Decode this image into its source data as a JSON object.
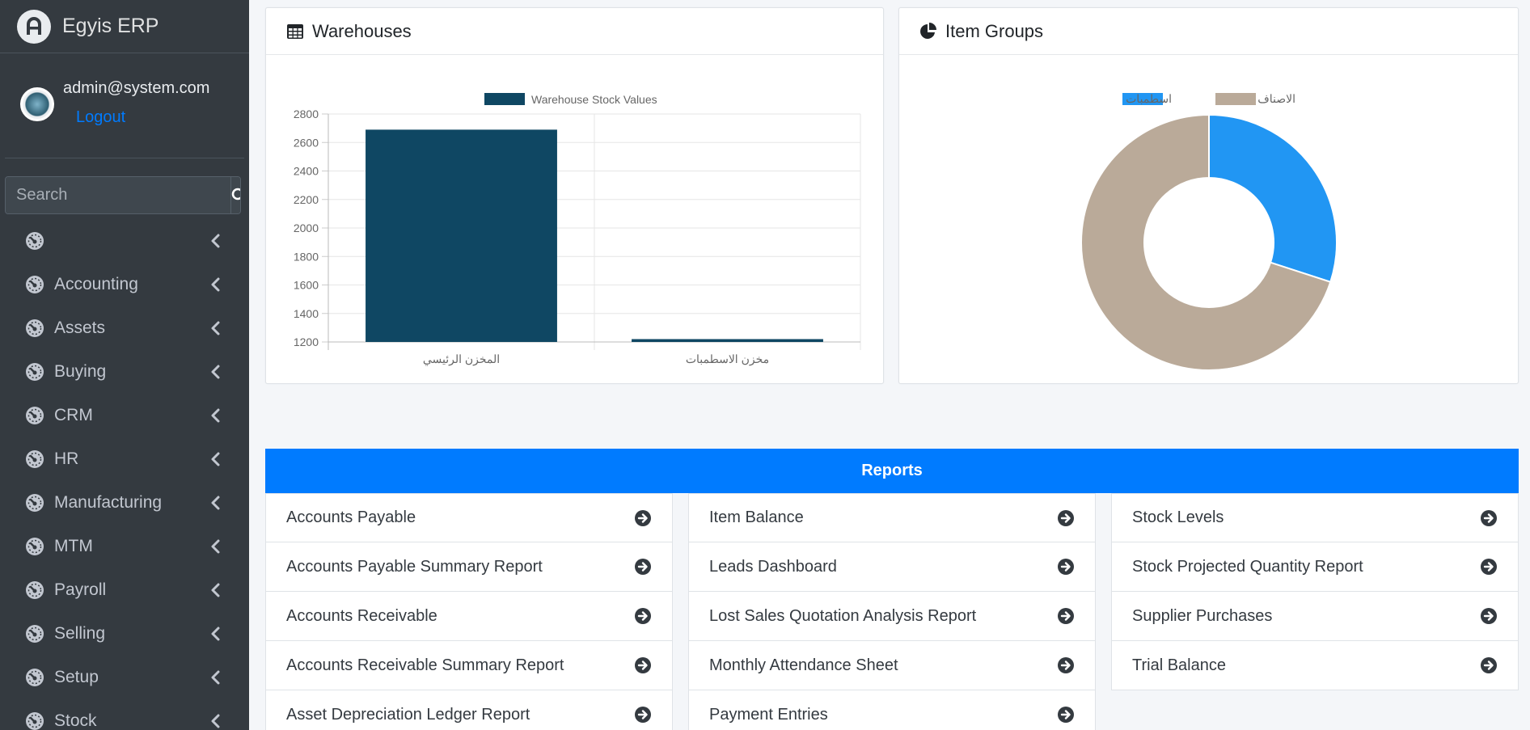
{
  "brand": {
    "name": "Egyis ERP"
  },
  "user": {
    "email": "admin@system.com",
    "logout_label": "Logout"
  },
  "search": {
    "placeholder": "Search"
  },
  "nav": [
    {
      "label": ""
    },
    {
      "label": "Accounting"
    },
    {
      "label": "Assets"
    },
    {
      "label": "Buying"
    },
    {
      "label": "CRM"
    },
    {
      "label": "HR"
    },
    {
      "label": "Manufacturing"
    },
    {
      "label": "MTM"
    },
    {
      "label": "Payroll"
    },
    {
      "label": "Selling"
    },
    {
      "label": "Setup"
    },
    {
      "label": "Stock"
    }
  ],
  "warehouses": {
    "title": "Warehouses",
    "chart_data": {
      "type": "bar",
      "categories": [
        "المخزن الرئيسي",
        "مخزن الاسطمبات"
      ],
      "series": [
        {
          "name": "Warehouse Stock Values",
          "values": [
            2690,
            1220
          ]
        }
      ],
      "ylim": [
        1200,
        2800
      ],
      "yticks": [
        1200,
        1400,
        1600,
        1800,
        2000,
        2200,
        2400,
        2600,
        2800
      ],
      "legend": "top-center",
      "grid": true,
      "color": "#0f4763"
    }
  },
  "item_groups": {
    "title": "Item Groups",
    "chart_data": {
      "type": "pie",
      "labels": [
        "اسطمبات",
        "الاصناف"
      ],
      "values": [
        30,
        70
      ],
      "colors": [
        "#2196f3",
        "#baaa99"
      ],
      "legend": "top-center",
      "donut": true
    }
  },
  "reports": {
    "title": "Reports",
    "columns": [
      [
        "Accounts Payable",
        "Accounts Payable Summary Report",
        "Accounts Receivable",
        "Accounts Receivable Summary Report",
        "Asset Depreciation Ledger Report"
      ],
      [
        "Item Balance",
        "Leads Dashboard",
        "Lost Sales Quotation Analysis Report",
        "Monthly Attendance Sheet",
        "Payment Entries"
      ],
      [
        "Stock Levels",
        "Stock Projected Quantity Report",
        "Supplier Purchases",
        "Trial Balance"
      ]
    ]
  },
  "colors": {
    "sidebar_bg": "#343a40",
    "accent": "#007bff",
    "bar": "#0f4763",
    "pie_primary": "#2196f3",
    "pie_secondary": "#baaa99"
  }
}
